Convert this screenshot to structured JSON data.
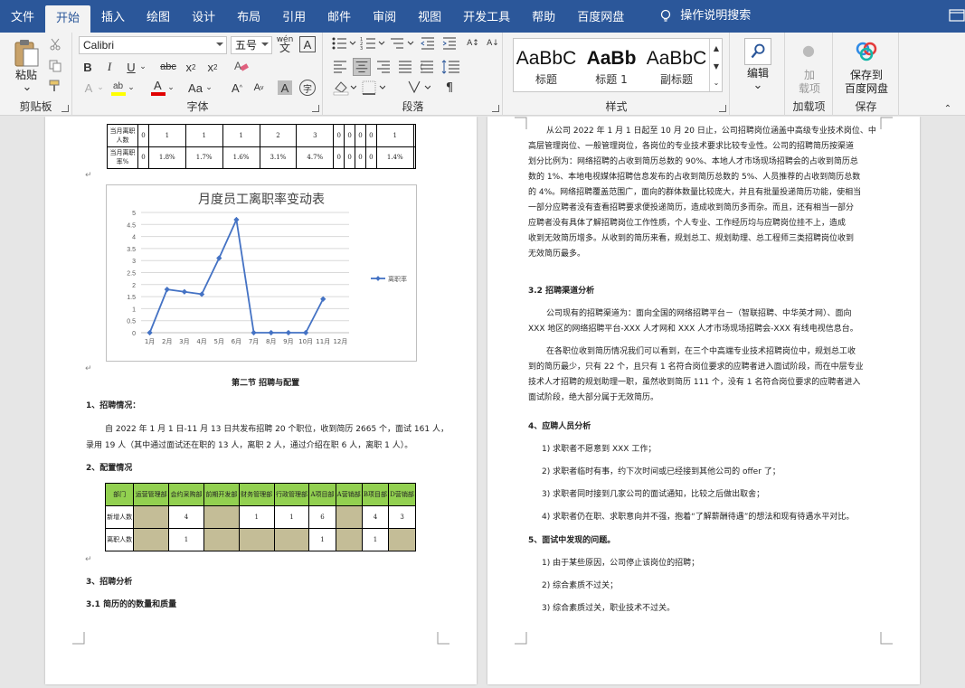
{
  "tabs": [
    "文件",
    "开始",
    "插入",
    "绘图",
    "设计",
    "布局",
    "引用",
    "邮件",
    "审阅",
    "视图",
    "开发工具",
    "帮助",
    "百度网盘"
  ],
  "active_tab": "开始",
  "tell_me": "操作说明搜索",
  "ribbon": {
    "clipboard": {
      "paste": "粘贴",
      "label": "剪贴板"
    },
    "font": {
      "name": "Calibri",
      "size": "五号",
      "label": "字体"
    },
    "paragraph": {
      "label": "段落"
    },
    "styles": {
      "label": "样式",
      "items": [
        {
          "sample": "AaBbC",
          "name": "标题"
        },
        {
          "sample": "AaBb",
          "name": "标题 1"
        },
        {
          "sample": "AaBbC",
          "name": "副标题"
        }
      ]
    },
    "editing": {
      "label": "编辑"
    },
    "addins": {
      "btn": "加载项",
      "label": "加载项"
    },
    "save": {
      "btn": "保存到\n百度网盘",
      "line1": "保存到",
      "line2": "百度网盘",
      "label": "保存"
    },
    "add_line1": "加",
    "add_line2": "载项"
  },
  "left_page": {
    "top_table": {
      "row1_label": "当月离职人数",
      "row1": [
        "0",
        "1",
        "1",
        "1",
        "2",
        "3",
        "0",
        "0",
        "0",
        "0",
        "1",
        ""
      ],
      "row2_label": "当月离职率%",
      "row2": [
        "0",
        "1.8%",
        "1.7%",
        "1.6%",
        "3.1%",
        "4.7%",
        "0",
        "0",
        "0",
        "0",
        "1.4%",
        ""
      ]
    },
    "section_title": "第二节  招聘与配置",
    "h1": "1、招聘情况：",
    "p1_l1": "自 2022 年 1 月 1 日-11 月 13 日共发布招聘 20 个职位，收到简历 2665 个，面试 161 人，",
    "p1_l2": "录用 19 人（其中通过面试还在职的 13 人，离职 2 人，通过介绍在职 6 人，离职 1 人）。",
    "h2": "2、配置情况",
    "dist_table": {
      "headers": [
        "部门",
        "运营管理部",
        "会约采购部",
        "前期开发部",
        "财务管理部",
        "行政管理部",
        "A项目部",
        "A营销部",
        "B项目部",
        "D营销部"
      ],
      "row1_label": "新增人数",
      "row1": [
        "",
        "4",
        "",
        "1",
        "1",
        "6",
        "",
        "4",
        "3"
      ],
      "row2_label": "离职人数",
      "row2": [
        "",
        "1",
        "",
        "",
        "",
        "1",
        "",
        "1",
        ""
      ]
    },
    "h3": "3、招聘分析",
    "h31": "3.1 简历的的数量和质量"
  },
  "chart_data": {
    "type": "line",
    "title": "月度员工离职率变动表",
    "categories": [
      "1月",
      "2月",
      "3月",
      "4月",
      "5月",
      "6月",
      "7月",
      "8月",
      "9月",
      "10月",
      "11月",
      "12月"
    ],
    "series": [
      {
        "name": "离职率",
        "values": [
          0,
          1.8,
          1.7,
          1.6,
          3.1,
          4.7,
          0,
          0,
          0,
          0,
          1.4,
          null
        ]
      }
    ],
    "yticks": [
      "0",
      "0.5",
      "1",
      "1.5",
      "2",
      "2.5",
      "3",
      "3.5",
      "4",
      "4.5",
      "5"
    ],
    "ylim": [
      0,
      5
    ],
    "grid": true,
    "legend": "right",
    "color": "#4472c4"
  },
  "right_page": {
    "p1": [
      "从公司 2022 年 1 月 1 日起至 10 月 20 日止，公司招聘岗位涵盖中高级专业技术岗位、中",
      "高层管理岗位、一般管理岗位，各岗位的专业技术要求比较专业性。公司的招聘简历按渠道",
      "划分比例为：网络招聘的占收到简历总数的 90%、本地人才市场现场招聘会的占收到简历总",
      "数的 1%、本地电视媒体招聘信息发布的占收到简历总数的 5%、人员推荐的占收到简历总数",
      "的 4%。网络招聘覆盖范围广，面向的群体数量比较庞大，并且有批量投递简历功能，使相当",
      "一部分应聘者没有查看招聘要求便投递简历，造成收到简历多而杂。而且，还有相当一部分",
      "应聘者没有具体了解招聘岗位工作性质，个人专业、工作经历均与应聘岗位挂不上，造成",
      "收到无效简历增多。从收到的简历来看，规划总工、规划助理、总工程师三类招聘岗位收到",
      "无效简历最多。"
    ],
    "h32": "3.2 招聘渠道分析",
    "p2": [
      "公司现有的招聘渠道为：面向全国的网络招聘平台－（智联招聘、中华英才网）、面向",
      "XXX 地区的网络招聘平台-XXX 人才网和 XXX 人才市场现场招聘会-XXX 有线电视信息台。"
    ],
    "p3": [
      "在各职位收到简历情况我们可以看到，在三个中高端专业技术招聘岗位中，规划总工收",
      "到的简历最少，只有 22 个，且只有 1 名符合岗位要求的应聘者进入面试阶段，而在中层专业",
      "技术人才招聘的规划助理一职，虽然收到简历 111 个，没有 1 名符合岗位要求的应聘者进入",
      "面试阶段，绝大部分属于无效简历。"
    ],
    "h4": "4、应聘人员分析",
    "list4": [
      "1)  求职者不愿意到 XXX 工作；",
      "2)  求职者临时有事，约下次时间或已经接到其他公司的 offer 了；",
      "3)  求职者同时接到几家公司的面试通知，比较之后做出取舍；",
      "4)  求职者仍在职、求职意向并不强，抱着“了解薪酬待遇”的想法和现有待遇水平对比。"
    ],
    "h5": "5、面试中发现的问题。",
    "list5": [
      "1)  由于某些原因，公司停止该岗位的招聘；",
      "2)  综合素质不过关；",
      "3)  综合素质过关，职业技术不过关。"
    ]
  }
}
